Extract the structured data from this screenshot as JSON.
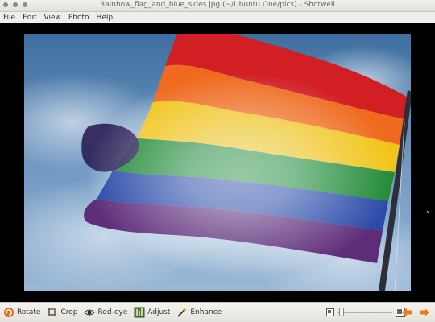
{
  "window": {
    "title": "Rainbow_flag_and_blue_skies.jpg (~/Ubuntu One/pics) - Shotwell"
  },
  "menu": {
    "items": [
      "File",
      "Edit",
      "View",
      "Photo",
      "Help"
    ]
  },
  "viewer": {
    "side_arrow": "›"
  },
  "toolbar": {
    "rotate_label": "Rotate",
    "crop_label": "Crop",
    "redeye_label": "Red-eye",
    "adjust_label": "Adjust",
    "enhance_label": "Enhance",
    "zoom_level": 0.03
  },
  "icons": {
    "rotate": "rotate-icon",
    "crop": "crop-icon",
    "redeye": "red-eye-icon",
    "adjust": "adjust-icon",
    "enhance": "enhance-icon",
    "zoom_out": "zoom-out-icon",
    "zoom_in": "zoom-in-icon",
    "prev": "previous-arrow-icon",
    "next": "next-arrow-icon"
  },
  "colors": {
    "nav_arrow": "#f07a12",
    "rotate_icon": "#e8661d",
    "viewer_bg": "#000000"
  }
}
